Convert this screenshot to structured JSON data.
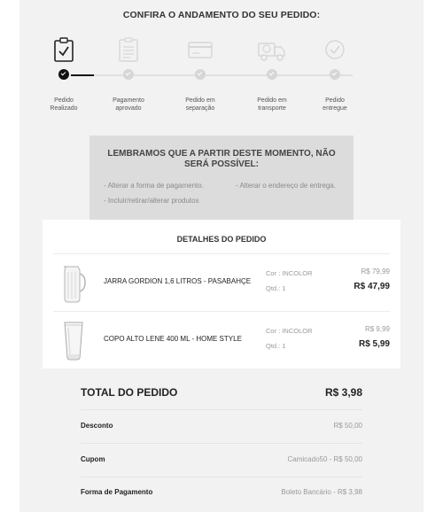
{
  "progress": {
    "title": "CONFIRA O ANDAMENTO DO SEU PEDIDO:",
    "steps": [
      {
        "label_1": "Pedido",
        "label_2": "Realizado",
        "icon": "clipboard-check-icon",
        "active": true
      },
      {
        "label_1": "Pagamento",
        "label_2": "aprovado",
        "icon": "document-list-icon",
        "active": false
      },
      {
        "label_1": "Pedido em",
        "label_2": "separação",
        "icon": "credit-card-icon",
        "active": false
      },
      {
        "label_1": "Pedido em",
        "label_2": "transporte",
        "icon": "delivery-truck-icon",
        "active": false
      },
      {
        "label_1": "Pedido",
        "label_2": "entregue",
        "icon": "check-circle-icon",
        "active": false
      }
    ]
  },
  "notice": {
    "title": "LEMBRAMOS QUE A PARTIR DESTE MOMENTO, NÃO SERÁ POSSÍVEL:",
    "items": [
      "- Alterar a forma de pagamento.",
      "- Alterar o endereço de entrega.",
      "- Incluir/retirar/alterar produtos"
    ]
  },
  "details": {
    "title": "DETALHES DO PEDIDO",
    "products": [
      {
        "name": "JARRA GORDION 1,6 LITROS - PASABAHÇE",
        "color": "Cor : INCOLOR",
        "qty": "Qtd.: 1",
        "old_price": "R$ 79,99",
        "price": "R$ 47,99",
        "icon": "glass-jar-icon"
      },
      {
        "name": "COPO ALTO LENE 400 ML - HOME STYLE",
        "color": "Cor : INCOLOR",
        "qty": "Qtd.: 1",
        "old_price": "R$ 9,99",
        "price": "R$ 5,99",
        "icon": "tall-glass-icon"
      }
    ]
  },
  "summary": {
    "total_label": "TOTAL DO PEDIDO",
    "total_value": "R$ 3,98",
    "rows": [
      {
        "label": "Desconto",
        "value": "R$ 50,00"
      },
      {
        "label": "Cupom",
        "value": "Camicado50 - R$ 50,00"
      },
      {
        "label": "Forma de Pagamento",
        "value": "Boleto Bancário - R$ 3,98"
      }
    ]
  },
  "colors": {
    "background": "#f2f2f2",
    "panel": "#ffffff",
    "notice": "#dcdcdc",
    "active": "#111111",
    "inactive": "#d6d6d6"
  }
}
